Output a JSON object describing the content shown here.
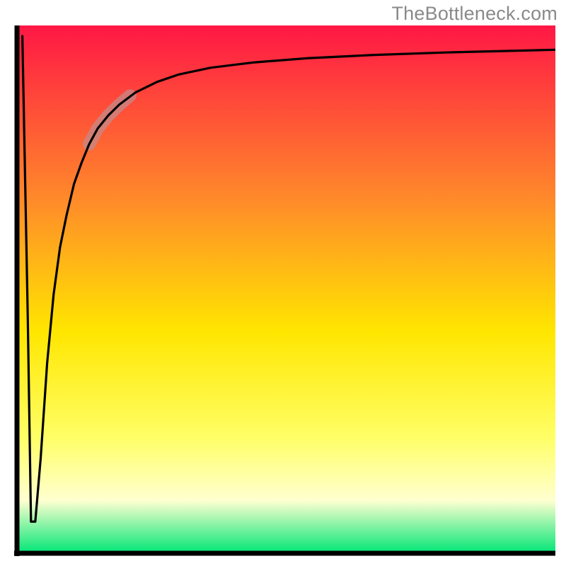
{
  "watermark": "TheBottleneck.com",
  "colors": {
    "watermark_text": "#8a8a8a",
    "gradient_top": "#ff1745",
    "gradient_mid_upper": "#ff8a2a",
    "gradient_mid": "#ffe600",
    "gradient_lower": "#ffff66",
    "gradient_pale": "#ffffd0",
    "gradient_bottom": "#00e676",
    "axis": "#000000",
    "curve": "#000000",
    "highlight": "#c48a8a"
  },
  "chart_data": {
    "type": "line",
    "title": "",
    "xlabel": "",
    "ylabel": "",
    "x_range": [
      0,
      100
    ],
    "y_range": [
      0,
      100
    ],
    "note": "Numeric values are estimated from pixel positions; the source chart has no axis tick labels, so units are relative to the visible axis range.",
    "series": [
      {
        "name": "bottleneck-curve",
        "x": [
          1.0,
          2.0,
          2.6,
          3.4,
          4.4,
          5.6,
          6.8,
          8.0,
          9.2,
          10.6,
          12.0,
          13.4,
          15.0,
          17.0,
          19.0,
          22.0,
          26.0,
          30.0,
          36.0,
          44.0,
          54.0,
          66.0,
          80.0,
          100.0
        ],
        "y": [
          98.0,
          45.0,
          6.0,
          6.0,
          18.0,
          36.0,
          49.0,
          58.0,
          64.0,
          70.0,
          74.0,
          77.5,
          80.5,
          83.0,
          85.0,
          87.3,
          89.3,
          90.7,
          92.0,
          93.0,
          93.8,
          94.4,
          94.9,
          95.4
        ]
      }
    ],
    "highlight_segment": {
      "x": [
        13.4,
        15.0,
        17.0,
        19.0,
        21.0
      ],
      "y": [
        77.5,
        80.5,
        83.0,
        85.0,
        86.7
      ]
    },
    "optimal_point": {
      "x": 3.0,
      "y": 6.0
    }
  }
}
